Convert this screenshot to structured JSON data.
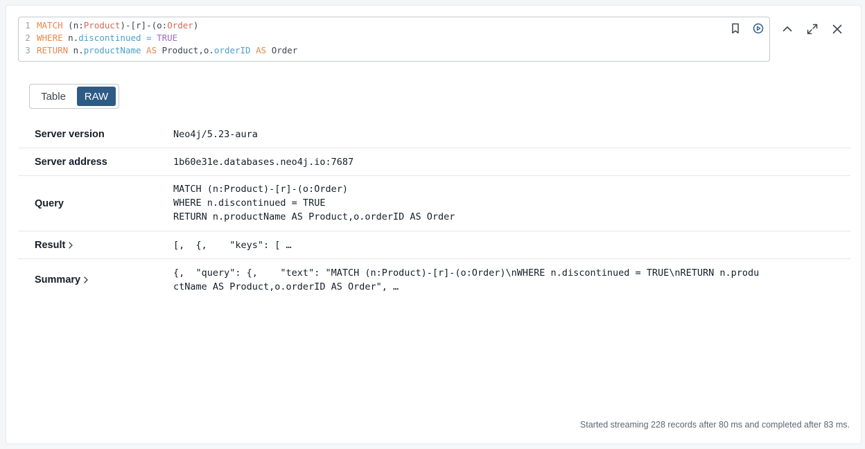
{
  "editor": {
    "lines": [
      {
        "num": "1",
        "tokens": [
          {
            "t": "MATCH",
            "c": "kw"
          },
          {
            "t": " (",
            "c": "pl"
          },
          {
            "t": "n",
            "c": "pl"
          },
          {
            "t": ":",
            "c": "pl"
          },
          {
            "t": "Product",
            "c": "lbl"
          },
          {
            "t": ")-[r]-(",
            "c": "pl"
          },
          {
            "t": "o",
            "c": "pl"
          },
          {
            "t": ":",
            "c": "pl"
          },
          {
            "t": "Order",
            "c": "lbl"
          },
          {
            "t": ")",
            "c": "pl"
          }
        ]
      },
      {
        "num": "2",
        "tokens": [
          {
            "t": "WHERE",
            "c": "kw"
          },
          {
            "t": " n.",
            "c": "pl"
          },
          {
            "t": "discontinued",
            "c": "prop"
          },
          {
            "t": " = ",
            "c": "prop"
          },
          {
            "t": "TRUE",
            "c": "bool"
          }
        ]
      },
      {
        "num": "3",
        "tokens": [
          {
            "t": "RETURN",
            "c": "kw"
          },
          {
            "t": " n.",
            "c": "pl"
          },
          {
            "t": "productName",
            "c": "prop"
          },
          {
            "t": " AS",
            "c": "kw"
          },
          {
            "t": " Product,o.",
            "c": "pl"
          },
          {
            "t": "orderID",
            "c": "prop"
          },
          {
            "t": " AS",
            "c": "kw"
          },
          {
            "t": " Order",
            "c": "pl"
          }
        ]
      }
    ]
  },
  "view_toggle": {
    "table_label": "Table",
    "raw_label": "RAW",
    "selected": "RAW"
  },
  "rows": {
    "server_version": {
      "label": "Server version",
      "value": "Neo4j/5.23-aura"
    },
    "server_address": {
      "label": "Server address",
      "value": "1b60e31e.databases.neo4j.io:7687"
    },
    "query": {
      "label": "Query",
      "value": "MATCH (n:Product)-[r]-(o:Order)\nWHERE n.discontinued = TRUE\nRETURN n.productName AS Product,o.orderID AS Order"
    },
    "result": {
      "label": "Result",
      "value": "[,  {,    \"keys\": [ …"
    },
    "summary": {
      "label": "Summary",
      "value": "{,  \"query\": {,    \"text\": \"MATCH (n:Product)-[r]-(o:Order)\\nWHERE n.discontinued = TRUE\\nRETURN n.productName AS Product,o.orderID AS Order\", …"
    }
  },
  "status": "Started streaming 228 records after 80 ms and completed after 83 ms.",
  "colors": {
    "accent": "#2d5b86",
    "keyword": "#e8884a",
    "label": "#d6675c",
    "property": "#4ba0c9",
    "boolean": "#a168c9"
  },
  "icons": [
    "bookmark-icon",
    "run-icon",
    "chevron-up-icon",
    "expand-icon",
    "close-icon",
    "chevron-right-icon"
  ]
}
